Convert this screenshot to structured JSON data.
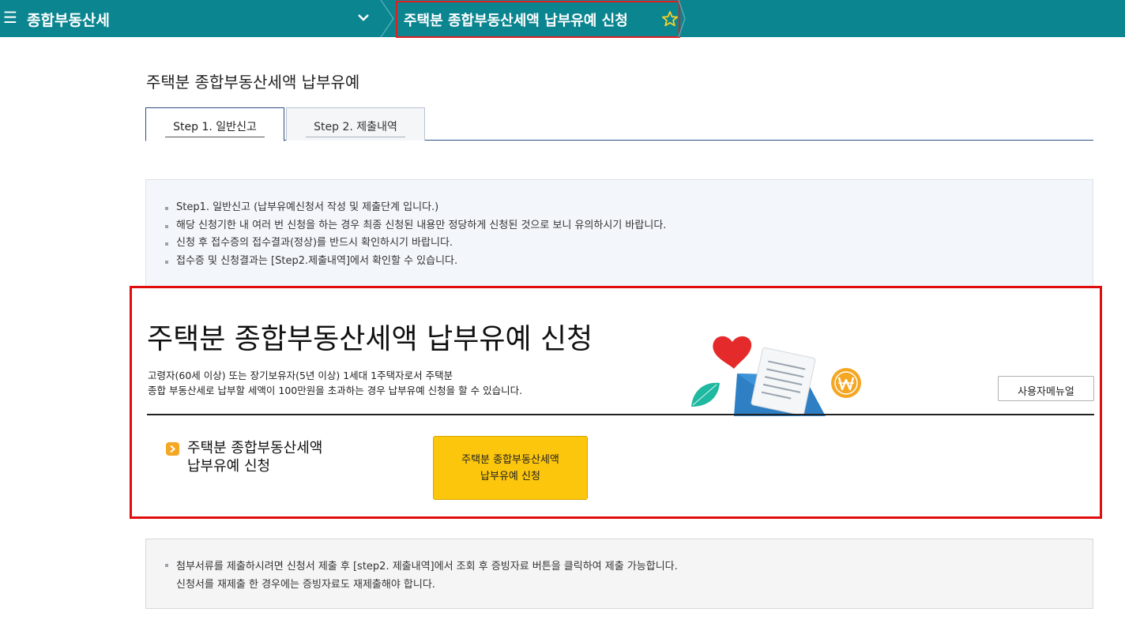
{
  "header": {
    "app_title": "종합부동산세",
    "current_page": "주택분 종합부동산세액 납부유예 신청",
    "menu_icon": "hamburger-icon",
    "favorite_icon": "star-outline-icon",
    "bar_color": "#0b8590"
  },
  "page": {
    "title": "주택분 종합부동산세액 납부유예"
  },
  "tabs": [
    {
      "label": "Step 1. 일반신고",
      "active": true
    },
    {
      "label": "Step 2. 제출내역",
      "active": false
    }
  ],
  "info": {
    "items": [
      "Step1. 일반신고 (납부유예신청서 작성 및 제출단계 입니다.)",
      "해당 신청기한 내 여러 번 신청을 하는 경우 최종 신청된 내용만 정당하게 신청된 것으로 보니 유의하시기 바랍니다.",
      "신청 후 접수증의 접수결과(정상)를 반드시 확인하시기 바랍니다.",
      "접수증 및 신청결과는 [Step2.제출내역]에서 확인할 수 있습니다."
    ]
  },
  "main": {
    "title": "주택분 종합부동산세액 납부유예 신청",
    "desc_line1": "고령자(60세 이상) 또는 장기보유자(5년 이상) 1세대 1주택자로서 주택분",
    "desc_line2": "종합 부동산세로 납부할 세액이 100만원을 초과하는 경우 납부유예 신청을 할 수 있습니다.",
    "manual_button": "사용자메뉴얼",
    "apply_label_line1": "주택분 종합부동산세액",
    "apply_label_line2": "납부유예 신청",
    "apply_button_line1": "주택분 종합부동산세액",
    "apply_button_line2": "납부유예 신청",
    "accent_color": "#fcc60d"
  },
  "notice": {
    "line1": "첨부서류를 제출하시려면 신청서 제출 후 [step2. 제출내역]에서 조회 후 증빙자료 버튼을 클릭하여 제출 가능합니다.",
    "line2": "신청서를 재제출 한 경우에는 증빙자료도 재제출해야 합니다."
  }
}
